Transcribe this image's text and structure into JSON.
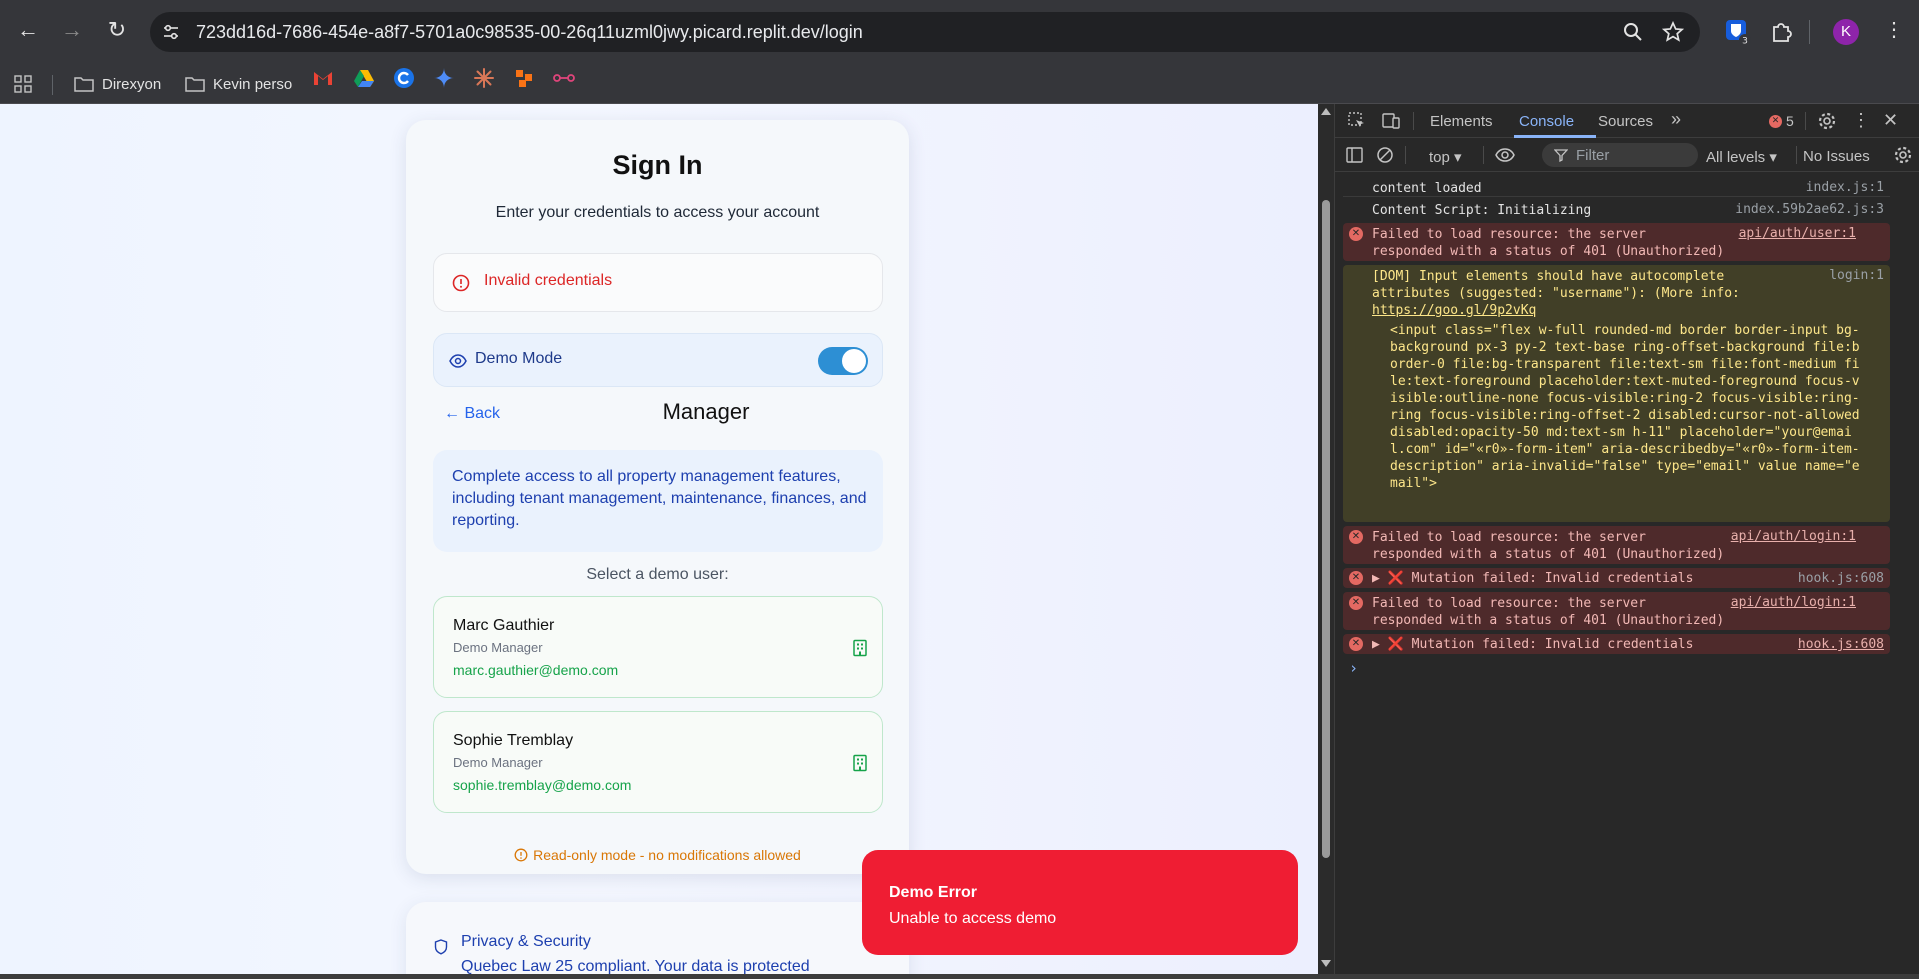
{
  "browser": {
    "url": "723dd16d-7686-454e-a8f7-5701a0c98535-00-26q11uzml0jwy.picard.replit.dev/login",
    "extension_badge": "3",
    "profile_initial": "K",
    "bookmarks": [
      {
        "label": "Direxyon",
        "icon": "folder-icon"
      },
      {
        "label": "Kevin perso",
        "icon": "folder-icon"
      }
    ]
  },
  "signin": {
    "title": "Sign In",
    "subtitle": "Enter your credentials to access your account",
    "alert": "Invalid credentials",
    "demo_mode_label": "Demo Mode",
    "demo_mode_on": true,
    "back_label": "← Back",
    "role_title": "Manager",
    "role_description": "Complete access to all property management features, including tenant management, maintenance, finances, and reporting.",
    "select_label": "Select a demo user:",
    "users": [
      {
        "name": "Marc Gauthier",
        "role": "Demo Manager",
        "email": "marc.gauthier@demo.com"
      },
      {
        "name": "Sophie Tremblay",
        "role": "Demo Manager",
        "email": "sophie.tremblay@demo.com"
      }
    ],
    "readonly_note": "Read-only mode - no modifications allowed"
  },
  "privacy": {
    "title": "Privacy & Security",
    "description": "Quebec Law 25 compliant. Your data is protected"
  },
  "toast": {
    "title": "Demo Error",
    "message": "Unable to access demo"
  },
  "devtools": {
    "tabs": [
      "Elements",
      "Console",
      "Sources"
    ],
    "active_tab": "Console",
    "error_count": "5",
    "context": "top",
    "filter_placeholder": "Filter",
    "levels": "All levels",
    "issues": "No Issues",
    "logs": [
      {
        "type": "info",
        "text": "content loaded",
        "source": "index.js:1"
      },
      {
        "type": "info",
        "text": "Content Script: Initializing",
        "source": "index.59b2ae62.js:3"
      },
      {
        "type": "error",
        "text": "Failed to load resource: the server\nresponded with a status of 401 (Unauthorized)",
        "source": "api/auth/user:1"
      },
      {
        "type": "warn",
        "text": "[DOM] Input elements should have autocomplete\nattributes (suggested: \"username\"): (More info:",
        "link": "https://goo.gl/9p2vKq",
        "source": "login:1",
        "snippet": "<input class=\"flex w-full rounded-md border border-input bg-\nbackground px-3 py-2 text-base ring-offset-background file:b\norder-0 file:bg-transparent file:text-sm file:font-medium fi\nle:text-foreground placeholder:text-muted-foreground focus-v\nisible:outline-none focus-visible:ring-2 focus-visible:ring-\nring focus-visible:ring-offset-2 disabled:cursor-not-allowed\ndisabled:opacity-50 md:text-sm h-11\" placeholder=\"your@emai\nl.com\" id=\"«r0»-form-item\" aria-describedby=\"«r0»-form-item-\ndescription\" aria-invalid=\"false\" type=\"email\" value name=\"e\nmail\">"
      },
      {
        "type": "error",
        "text": "Failed to load resource: the server\nresponded with a status of 401 (Unauthorized)",
        "source": "api/auth/login:1"
      },
      {
        "type": "error",
        "text": "▶ ❌ Mutation failed: Invalid credentials",
        "source": "hook.js:608"
      },
      {
        "type": "error",
        "text": "Failed to load resource: the server\nresponded with a status of 401 (Unauthorized)",
        "source": "api/auth/login:1"
      },
      {
        "type": "error",
        "text": "▶ ❌ Mutation failed: Invalid credentials",
        "source": "hook.js:608"
      }
    ],
    "prompt": "›"
  },
  "colors": {
    "accent_blue": "#2563eb",
    "error_red": "#dc2626",
    "toast_red": "#ef1d33",
    "success_green": "#16a34a",
    "warning_amber": "#d97706"
  }
}
